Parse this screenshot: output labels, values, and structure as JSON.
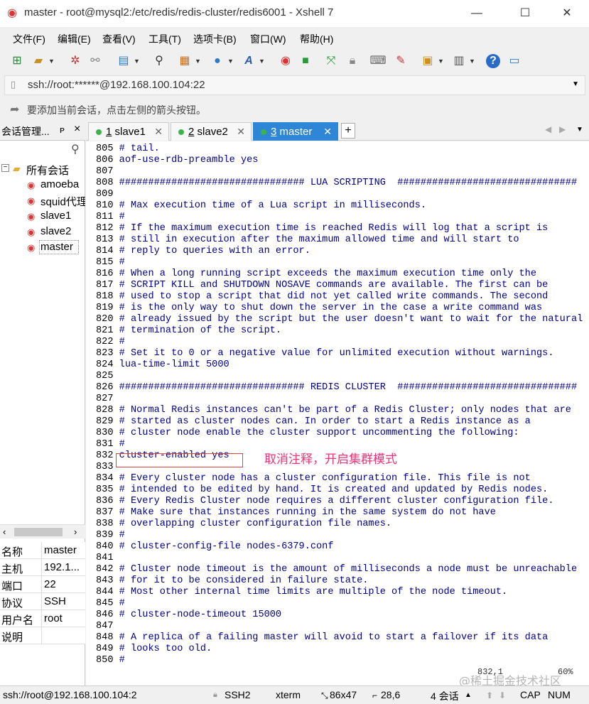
{
  "window": {
    "title": "master - root@mysql2:/etc/redis/redis-cluster/redis6001 - Xshell 7",
    "minimize": "—",
    "maximize": "☐",
    "close": "✕"
  },
  "menu": [
    "文件(F)",
    "编辑(E)",
    "查看(V)",
    "工具(T)",
    "选项卡(B)",
    "窗口(W)",
    "帮助(H)"
  ],
  "address": {
    "value": "ssh://root:******@192.168.100.104:22"
  },
  "hint": {
    "text": "要添加当前会话，点击左侧的箭头按钮。"
  },
  "session_manager": {
    "title": "会话管理...",
    "pin": "ᴘ",
    "close": "×",
    "search_icon": "⚲",
    "root_folder": "所有会话",
    "sessions": [
      "amoeba",
      "squid代理",
      "slave1",
      "slave2",
      "master"
    ],
    "properties": [
      {
        "k": "名称",
        "v": "master"
      },
      {
        "k": "主机",
        "v": "192.1..."
      },
      {
        "k": "端口",
        "v": "22"
      },
      {
        "k": "协议",
        "v": "SSH"
      },
      {
        "k": "用户名",
        "v": "root"
      },
      {
        "k": "说明",
        "v": ""
      }
    ]
  },
  "tabs": [
    {
      "num": "1",
      "name": "slave1",
      "active": false
    },
    {
      "num": "2",
      "name": "slave2",
      "active": false
    },
    {
      "num": "3",
      "name": "master",
      "active": true
    }
  ],
  "tab_add": "+",
  "terminal": {
    "lines": [
      {
        "n": "805",
        "t": "# tail."
      },
      {
        "n": "806",
        "t": "aof-use-rdb-preamble yes"
      },
      {
        "n": "807",
        "t": ""
      },
      {
        "n": "808",
        "t": "################################ LUA SCRIPTING  ###############################"
      },
      {
        "n": "809",
        "t": ""
      },
      {
        "n": "810",
        "t": "# Max execution time of a Lua script in milliseconds."
      },
      {
        "n": "811",
        "t": "#"
      },
      {
        "n": "812",
        "t": "# If the maximum execution time is reached Redis will log that a script is"
      },
      {
        "n": "813",
        "t": "# still in execution after the maximum allowed time and will start to"
      },
      {
        "n": "814",
        "t": "# reply to queries with an error."
      },
      {
        "n": "815",
        "t": "#"
      },
      {
        "n": "816",
        "t": "# When a long running script exceeds the maximum execution time only the"
      },
      {
        "n": "817",
        "t": "# SCRIPT KILL and SHUTDOWN NOSAVE commands are available. The first can be"
      },
      {
        "n": "818",
        "t": "# used to stop a script that did not yet called write commands. The second"
      },
      {
        "n": "819",
        "t": "# is the only way to shut down the server in the case a write command was"
      },
      {
        "n": "820",
        "t": "# already issued by the script but the user doesn't want to wait for the natural"
      },
      {
        "n": "821",
        "t": "# termination of the script."
      },
      {
        "n": "822",
        "t": "#"
      },
      {
        "n": "823",
        "t": "# Set it to 0 or a negative value for unlimited execution without warnings."
      },
      {
        "n": "824",
        "t": "lua-time-limit 5000"
      },
      {
        "n": "825",
        "t": ""
      },
      {
        "n": "826",
        "t": "################################ REDIS CLUSTER  ###############################"
      },
      {
        "n": "827",
        "t": ""
      },
      {
        "n": "828",
        "t": "# Normal Redis instances can't be part of a Redis Cluster; only nodes that are"
      },
      {
        "n": "829",
        "t": "# started as cluster nodes can. In order to start a Redis instance as a"
      },
      {
        "n": "830",
        "t": "# cluster node enable the cluster support uncommenting the following:"
      },
      {
        "n": "831",
        "t": "#"
      },
      {
        "n": "832",
        "t": "cluster-enabled yes"
      },
      {
        "n": "833",
        "t": ""
      },
      {
        "n": "834",
        "t": "# Every cluster node has a cluster configuration file. This file is not"
      },
      {
        "n": "835",
        "t": "# intended to be edited by hand. It is created and updated by Redis nodes."
      },
      {
        "n": "836",
        "t": "# Every Redis Cluster node requires a different cluster configuration file."
      },
      {
        "n": "837",
        "t": "# Make sure that instances running in the same system do not have"
      },
      {
        "n": "838",
        "t": "# overlapping cluster configuration file names."
      },
      {
        "n": "839",
        "t": "#"
      },
      {
        "n": "840",
        "t": "# cluster-config-file nodes-6379.conf"
      },
      {
        "n": "841",
        "t": ""
      },
      {
        "n": "842",
        "t": "# Cluster node timeout is the amount of milliseconds a node must be unreachable"
      },
      {
        "n": "843",
        "t": "# for it to be considered in failure state."
      },
      {
        "n": "844",
        "t": "# Most other internal time limits are multiple of the node timeout."
      },
      {
        "n": "845",
        "t": "#"
      },
      {
        "n": "846",
        "t": "# cluster-node-timeout 15000"
      },
      {
        "n": "847",
        "t": ""
      },
      {
        "n": "848",
        "t": "# A replica of a failing master will avoid to start a failover if its data"
      },
      {
        "n": "849",
        "t": "# looks too old."
      },
      {
        "n": "850",
        "t": "#"
      }
    ],
    "annotation": "取消注释，开启集群模式",
    "cursor_pos": "832,1",
    "scroll_pct": "60%"
  },
  "watermark": "@稀土掘金技术社区",
  "status": {
    "conn": "ssh://root@192.168.100.104:2",
    "proto": "SSH2",
    "term": "xterm",
    "size": "86x47",
    "pos": "28,6",
    "sessions": "4 会话",
    "cap": "CAP",
    "num": "NUM"
  }
}
